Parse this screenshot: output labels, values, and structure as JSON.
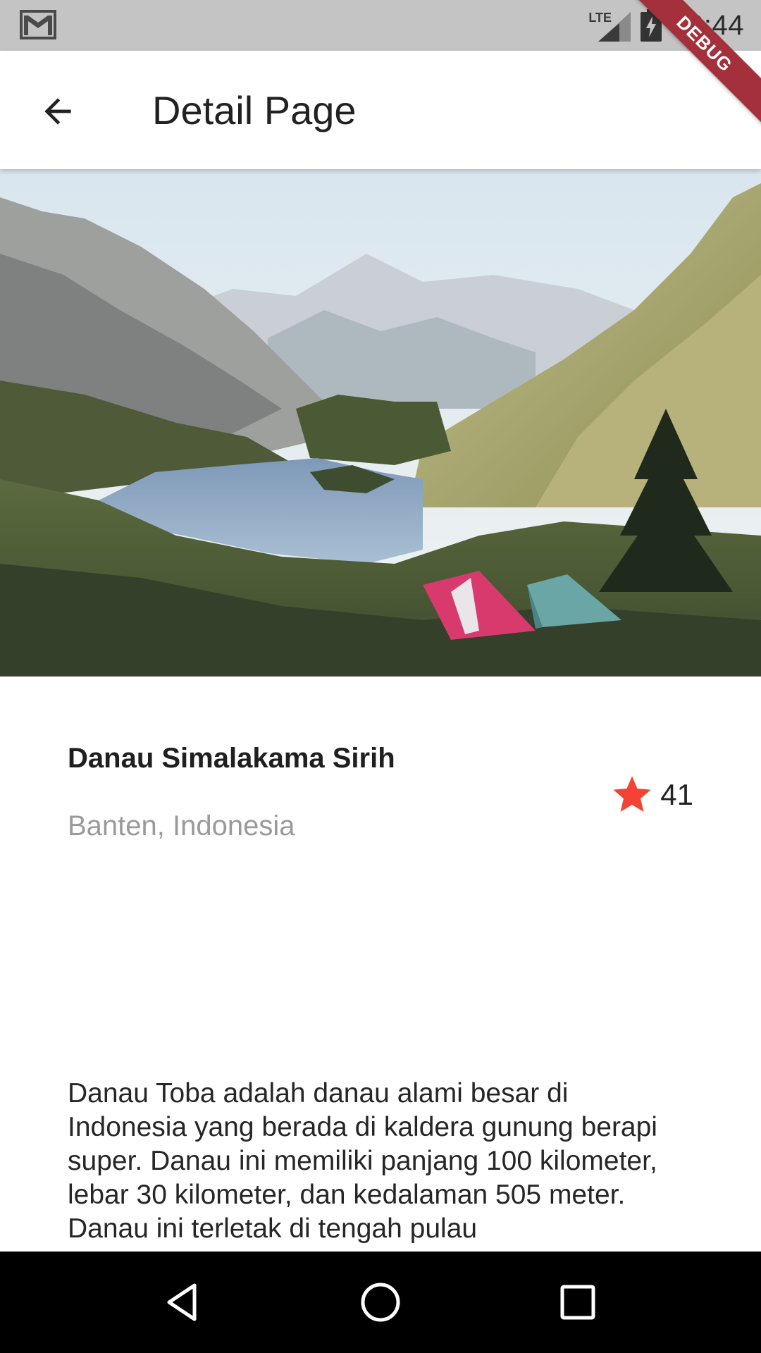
{
  "status_bar": {
    "network": "LTE",
    "time": "10:44",
    "icons": [
      "gmail-icon",
      "signal-icon",
      "battery-charging-icon"
    ]
  },
  "debug_banner": "DEBUG",
  "app_bar": {
    "title": "Detail Page",
    "back_icon": "arrow-back-icon"
  },
  "hero_image": {
    "subject": "mountain-lake-with-tents",
    "colors": {
      "sky": "#e8eef3",
      "lake": "#8aa6c2",
      "grass": "#4c5a36",
      "tent_pink": "#d93a6e",
      "tent_teal": "#6aa6a6"
    }
  },
  "place": {
    "name": "Danau Simalakama Sirih",
    "location": "Banten, Indonesia",
    "rating": "41",
    "rating_icon": "star-icon",
    "rating_color": "#f44336"
  },
  "description": "Danau Toba adalah danau alami besar di Indonesia yang berada di kaldera gunung berapi super. Danau ini memiliki panjang 100 kilometer, lebar 30 kilometer, dan kedalaman 505 meter. Danau ini terletak di tengah pulau",
  "nav_bar": {
    "back": "nav-back-icon",
    "home": "nav-home-icon",
    "recents": "nav-recents-icon"
  }
}
